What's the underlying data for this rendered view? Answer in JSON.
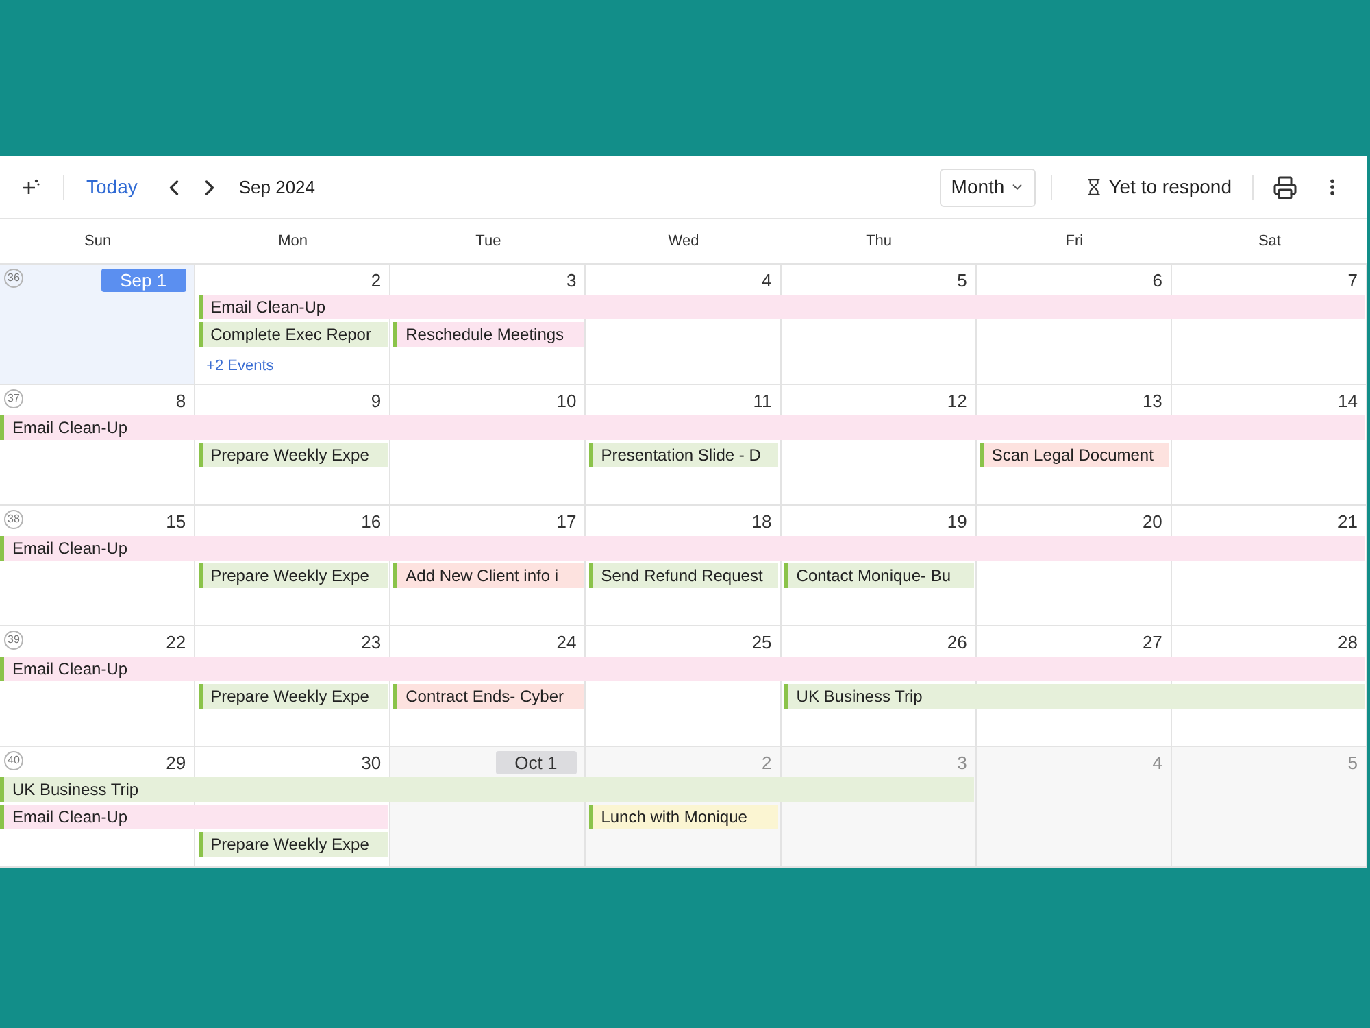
{
  "toolbar": {
    "today": "Today",
    "period": "Sep 2024",
    "view": "Month",
    "filter": "Yet to respond"
  },
  "weekdays": [
    "Sun",
    "Mon",
    "Tue",
    "Wed",
    "Thu",
    "Fri",
    "Sat"
  ],
  "weeks": [
    {
      "number": "36",
      "days": [
        {
          "label": "Sep 1",
          "first_of_month": true,
          "today": true,
          "in_month": true
        },
        {
          "label": "2",
          "first_of_month": false,
          "today": false,
          "in_month": true
        },
        {
          "label": "3",
          "first_of_month": false,
          "today": false,
          "in_month": true
        },
        {
          "label": "4",
          "first_of_month": false,
          "today": false,
          "in_month": true
        },
        {
          "label": "5",
          "first_of_month": false,
          "today": false,
          "in_month": true
        },
        {
          "label": "6",
          "first_of_month": false,
          "today": false,
          "in_month": true
        },
        {
          "label": "7",
          "first_of_month": false,
          "today": false,
          "in_month": true
        }
      ],
      "lanes": [
        [
          {
            "kind": "empty"
          },
          {
            "kind": "event",
            "title": "Email Clean-Up",
            "color": "#fce4ef"
          },
          {
            "kind": "continued"
          },
          {
            "kind": "continued"
          },
          {
            "kind": "continued"
          },
          {
            "kind": "continued"
          },
          {
            "kind": "continued"
          }
        ],
        [
          {
            "kind": "empty"
          },
          {
            "kind": "event",
            "title": "Complete Exec Repor",
            "color": "#e6f0da"
          },
          {
            "kind": "event",
            "title": "Reschedule Meetings",
            "color": "#fce4ef"
          },
          {
            "kind": "empty"
          },
          {
            "kind": "empty"
          },
          {
            "kind": "empty"
          },
          {
            "kind": "empty"
          }
        ],
        [
          {
            "kind": "empty"
          },
          {
            "kind": "more",
            "text": "+2 Events"
          },
          {
            "kind": "empty"
          },
          {
            "kind": "empty"
          },
          {
            "kind": "empty"
          },
          {
            "kind": "empty"
          },
          {
            "kind": "empty"
          }
        ]
      ]
    },
    {
      "number": "37",
      "days": [
        {
          "label": "8",
          "first_of_month": false,
          "today": false,
          "in_month": true
        },
        {
          "label": "9",
          "first_of_month": false,
          "today": false,
          "in_month": true
        },
        {
          "label": "10",
          "first_of_month": false,
          "today": false,
          "in_month": true
        },
        {
          "label": "11",
          "first_of_month": false,
          "today": false,
          "in_month": true
        },
        {
          "label": "12",
          "first_of_month": false,
          "today": false,
          "in_month": true
        },
        {
          "label": "13",
          "first_of_month": false,
          "today": false,
          "in_month": true
        },
        {
          "label": "14",
          "first_of_month": false,
          "today": false,
          "in_month": true
        }
      ],
      "lanes": [
        [
          {
            "kind": "event",
            "title": "Email Clean-Up",
            "color": "#fce4ef"
          },
          {
            "kind": "continued"
          },
          {
            "kind": "continued"
          },
          {
            "kind": "continued"
          },
          {
            "kind": "continued"
          },
          {
            "kind": "continued"
          },
          {
            "kind": "continued"
          }
        ],
        [
          {
            "kind": "empty"
          },
          {
            "kind": "event",
            "title": "Prepare Weekly Expe",
            "color": "#e6f0da"
          },
          {
            "kind": "empty"
          },
          {
            "kind": "event",
            "title": "Presentation Slide - D",
            "color": "#e6f0da"
          },
          {
            "kind": "empty"
          },
          {
            "kind": "event",
            "title": "Scan Legal Document",
            "color": "#fde2df"
          },
          {
            "kind": "empty"
          }
        ]
      ]
    },
    {
      "number": "38",
      "days": [
        {
          "label": "15",
          "first_of_month": false,
          "today": false,
          "in_month": true
        },
        {
          "label": "16",
          "first_of_month": false,
          "today": false,
          "in_month": true
        },
        {
          "label": "17",
          "first_of_month": false,
          "today": false,
          "in_month": true
        },
        {
          "label": "18",
          "first_of_month": false,
          "today": false,
          "in_month": true
        },
        {
          "label": "19",
          "first_of_month": false,
          "today": false,
          "in_month": true
        },
        {
          "label": "20",
          "first_of_month": false,
          "today": false,
          "in_month": true
        },
        {
          "label": "21",
          "first_of_month": false,
          "today": false,
          "in_month": true
        }
      ],
      "lanes": [
        [
          {
            "kind": "event",
            "title": "Email Clean-Up",
            "color": "#fce4ef"
          },
          {
            "kind": "continued"
          },
          {
            "kind": "continued"
          },
          {
            "kind": "continued"
          },
          {
            "kind": "continued"
          },
          {
            "kind": "continued"
          },
          {
            "kind": "continued"
          }
        ],
        [
          {
            "kind": "empty"
          },
          {
            "kind": "event",
            "title": "Prepare Weekly Expe",
            "color": "#e6f0da"
          },
          {
            "kind": "event",
            "title": "Add New Client info i",
            "color": "#fde2df"
          },
          {
            "kind": "event",
            "title": "Send Refund Request",
            "color": "#e6f0da"
          },
          {
            "kind": "event",
            "title": "Contact Monique- Bu",
            "color": "#e6f0da"
          },
          {
            "kind": "empty"
          },
          {
            "kind": "empty"
          }
        ]
      ]
    },
    {
      "number": "39",
      "days": [
        {
          "label": "22",
          "first_of_month": false,
          "today": false,
          "in_month": true
        },
        {
          "label": "23",
          "first_of_month": false,
          "today": false,
          "in_month": true
        },
        {
          "label": "24",
          "first_of_month": false,
          "today": false,
          "in_month": true
        },
        {
          "label": "25",
          "first_of_month": false,
          "today": false,
          "in_month": true
        },
        {
          "label": "26",
          "first_of_month": false,
          "today": false,
          "in_month": true
        },
        {
          "label": "27",
          "first_of_month": false,
          "today": false,
          "in_month": true
        },
        {
          "label": "28",
          "first_of_month": false,
          "today": false,
          "in_month": true
        }
      ],
      "lanes": [
        [
          {
            "kind": "event",
            "title": "Email Clean-Up",
            "color": "#fce4ef"
          },
          {
            "kind": "continued"
          },
          {
            "kind": "continued"
          },
          {
            "kind": "continued"
          },
          {
            "kind": "continued"
          },
          {
            "kind": "continued"
          },
          {
            "kind": "continued"
          }
        ],
        [
          {
            "kind": "empty"
          },
          {
            "kind": "event",
            "title": "Prepare Weekly Expe",
            "color": "#e6f0da"
          },
          {
            "kind": "event",
            "title": "Contract Ends- Cyber",
            "color": "#fde2df"
          },
          {
            "kind": "empty"
          },
          {
            "kind": "event",
            "title": "UK Business Trip",
            "color": "#e6f0da"
          },
          {
            "kind": "continued"
          },
          {
            "kind": "continued"
          }
        ]
      ]
    },
    {
      "number": "40",
      "days": [
        {
          "label": "29",
          "first_of_month": false,
          "today": false,
          "in_month": true
        },
        {
          "label": "30",
          "first_of_month": false,
          "today": false,
          "in_month": true
        },
        {
          "label": "Oct 1",
          "first_of_month": true,
          "today": false,
          "in_month": false
        },
        {
          "label": "2",
          "first_of_month": false,
          "today": false,
          "in_month": false
        },
        {
          "label": "3",
          "first_of_month": false,
          "today": false,
          "in_month": false
        },
        {
          "label": "4",
          "first_of_month": false,
          "today": false,
          "in_month": false
        },
        {
          "label": "5",
          "first_of_month": false,
          "today": false,
          "in_month": false
        }
      ],
      "lanes": [
        [
          {
            "kind": "event",
            "title": "UK Business Trip",
            "color": "#e6f0da"
          },
          {
            "kind": "continued"
          },
          {
            "kind": "continued"
          },
          {
            "kind": "continued"
          },
          {
            "kind": "continued"
          },
          {
            "kind": "empty"
          },
          {
            "kind": "empty"
          }
        ],
        [
          {
            "kind": "event",
            "title": "Email Clean-Up",
            "color": "#fce4ef"
          },
          {
            "kind": "continued"
          },
          {
            "kind": "empty"
          },
          {
            "kind": "event",
            "title": "Lunch with Monique",
            "color": "#fbf5d2"
          },
          {
            "kind": "empty"
          },
          {
            "kind": "empty"
          },
          {
            "kind": "empty"
          }
        ],
        [
          {
            "kind": "empty"
          },
          {
            "kind": "event",
            "title": "Prepare Weekly Expe",
            "color": "#e6f0da"
          },
          {
            "kind": "empty"
          },
          {
            "kind": "empty"
          },
          {
            "kind": "empty"
          },
          {
            "kind": "empty"
          },
          {
            "kind": "empty"
          }
        ]
      ]
    }
  ]
}
